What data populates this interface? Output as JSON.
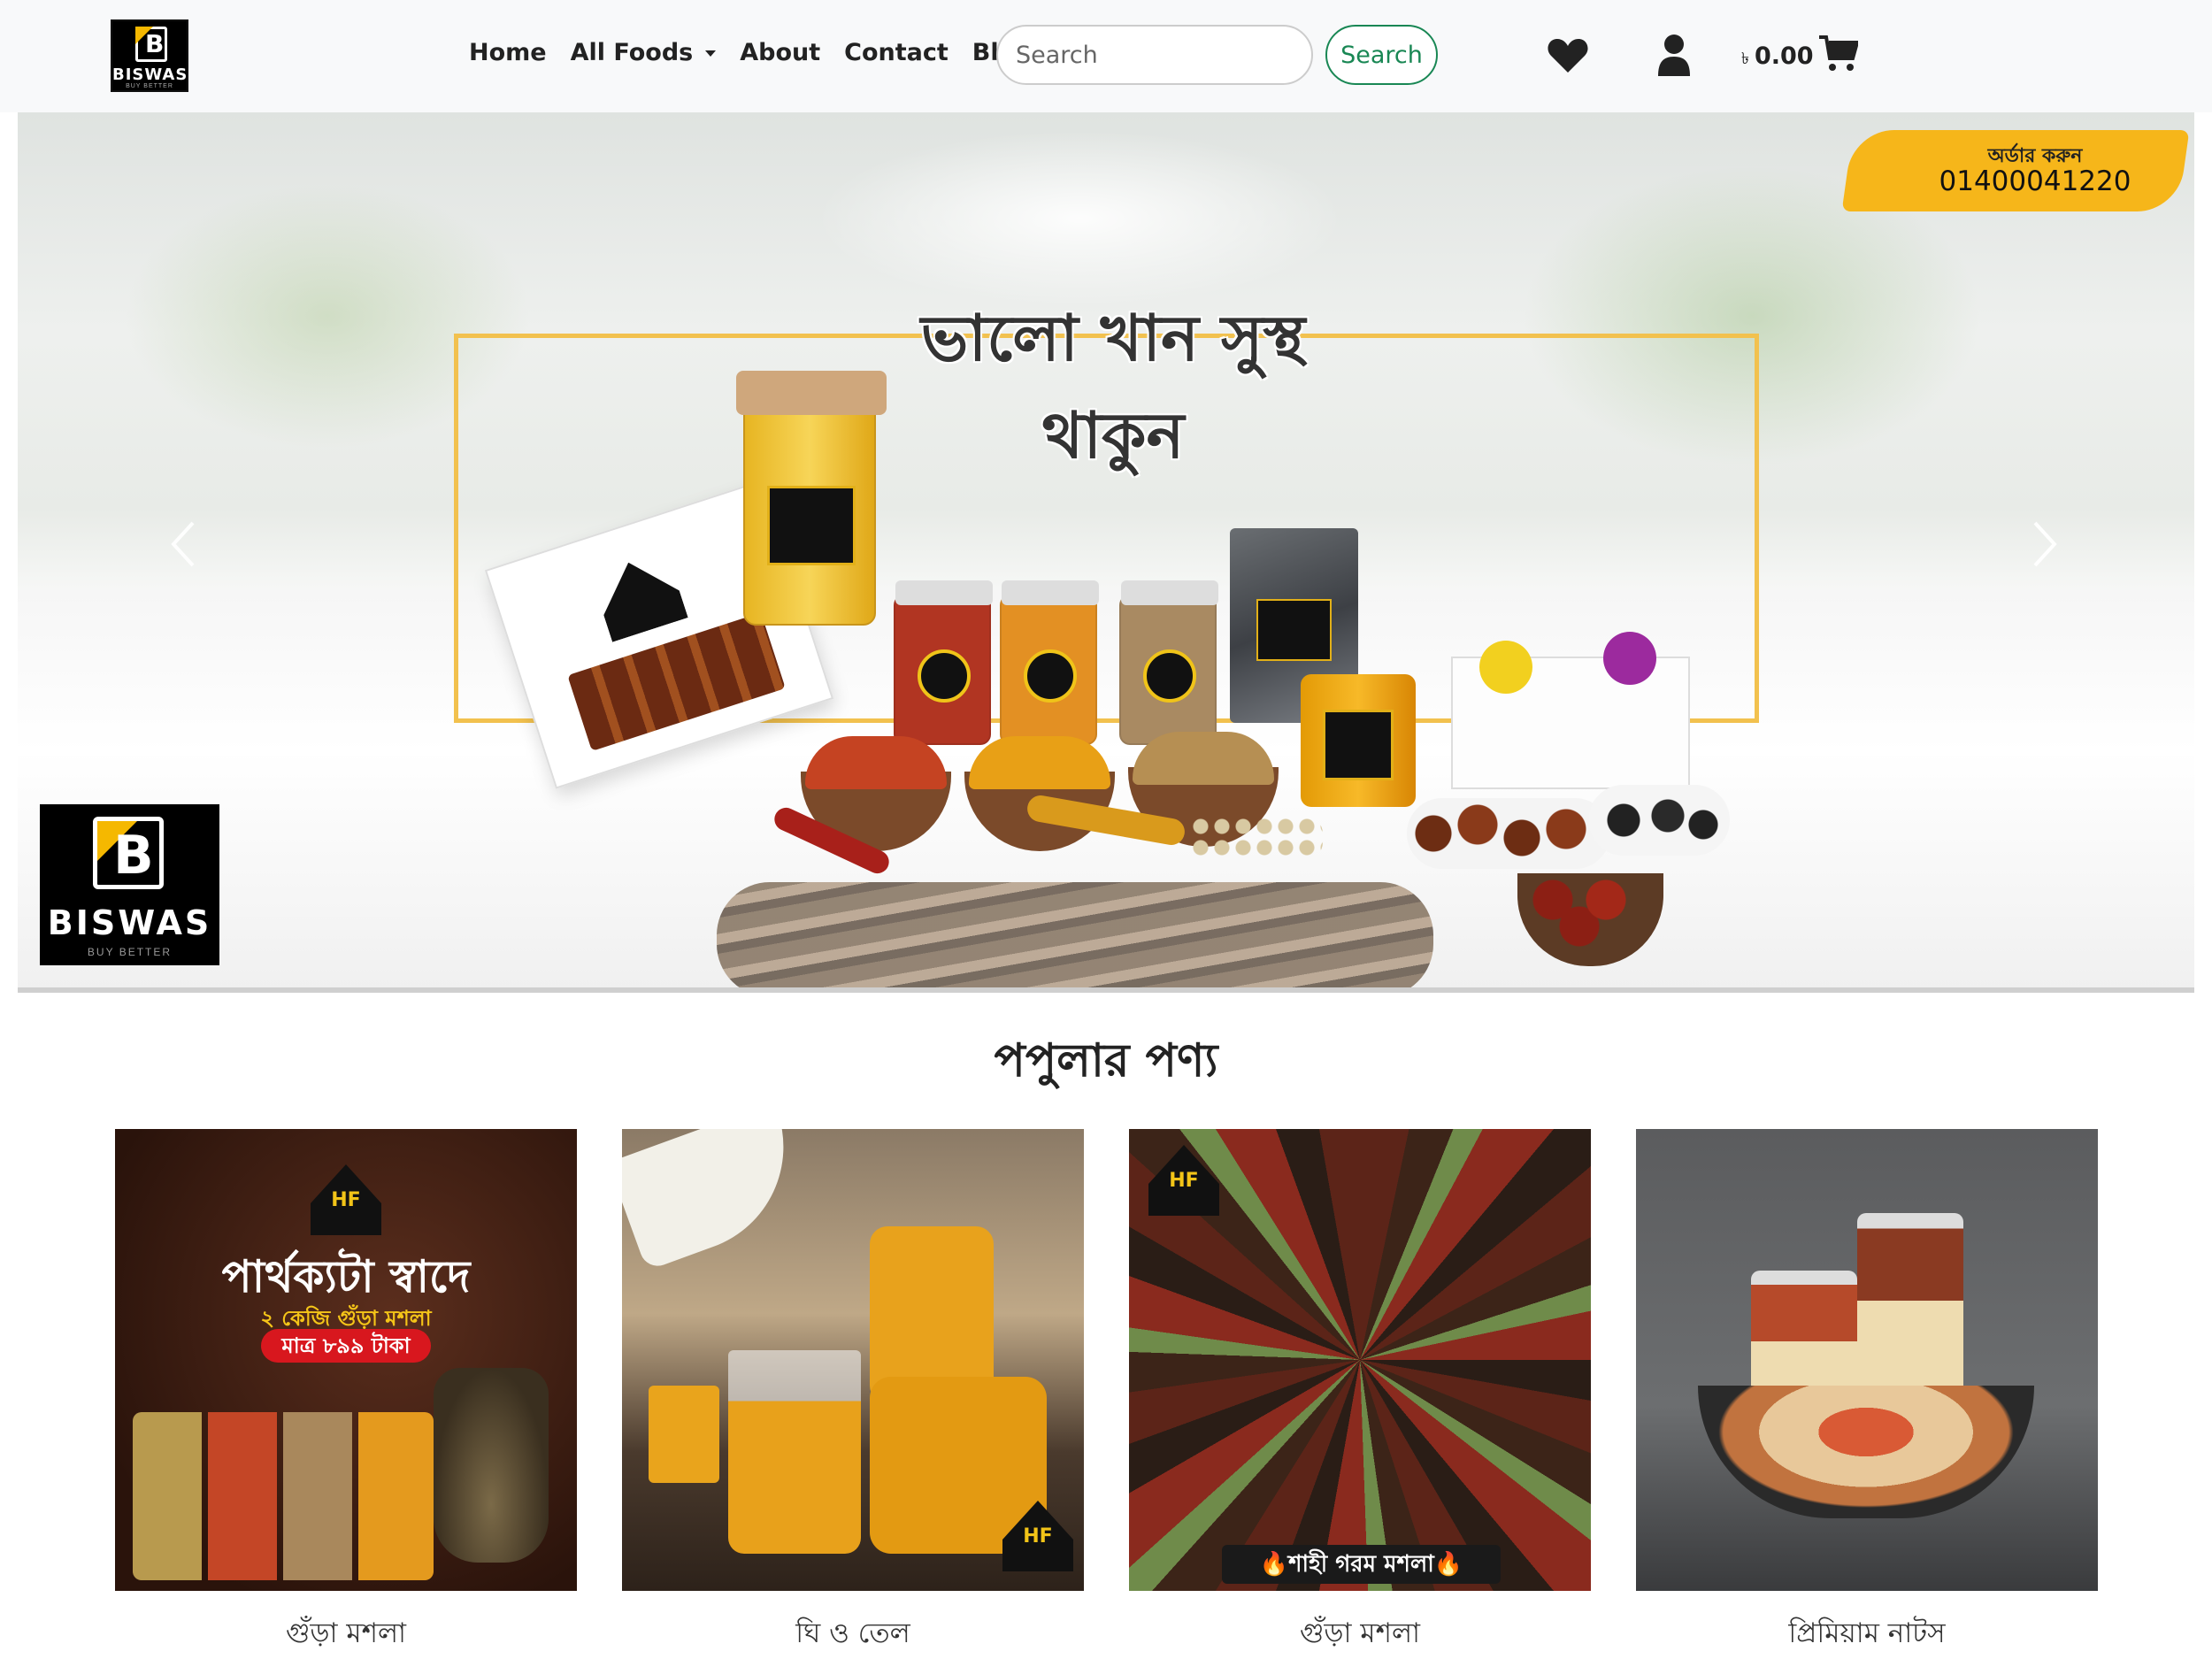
{
  "nav": {
    "logo_name": "BISWAS",
    "logo_tagline": "BUY BETTER",
    "links": [
      "Home",
      "All Foods",
      "About",
      "Contact",
      "Blog"
    ],
    "search_placeholder": "Search",
    "search_button": "Search",
    "cart_currency": "৳",
    "cart_total": "0.00",
    "icons": [
      "heart-icon",
      "user-icon",
      "cart-icon"
    ],
    "brand_color": "#198754"
  },
  "hero": {
    "slogan": "ভালো খান সুস্থ থাকুন",
    "order_label": "অর্ডার করুন",
    "order_phone": "01400041220",
    "logo_name": "BISWAS",
    "logo_tagline": "BUY BETTER",
    "accent_color": "#f6b61a"
  },
  "popular": {
    "title": "পপুলার পণ্য",
    "products": [
      {
        "name": "গুঁড়া মশলা",
        "promo_title": "পার্থক্যটা স্বাদে",
        "promo_sub": "২ কেজি গুঁড়া মশলা",
        "promo_price": "মাত্র ৮৯৯ টাকা"
      },
      {
        "name": "ঘি ও তেল"
      },
      {
        "name": "গুঁড়া মশলা",
        "banner": "🔥শাহী গরম মশলা🔥"
      },
      {
        "name": "প্রিমিয়াম নাটস"
      }
    ]
  }
}
